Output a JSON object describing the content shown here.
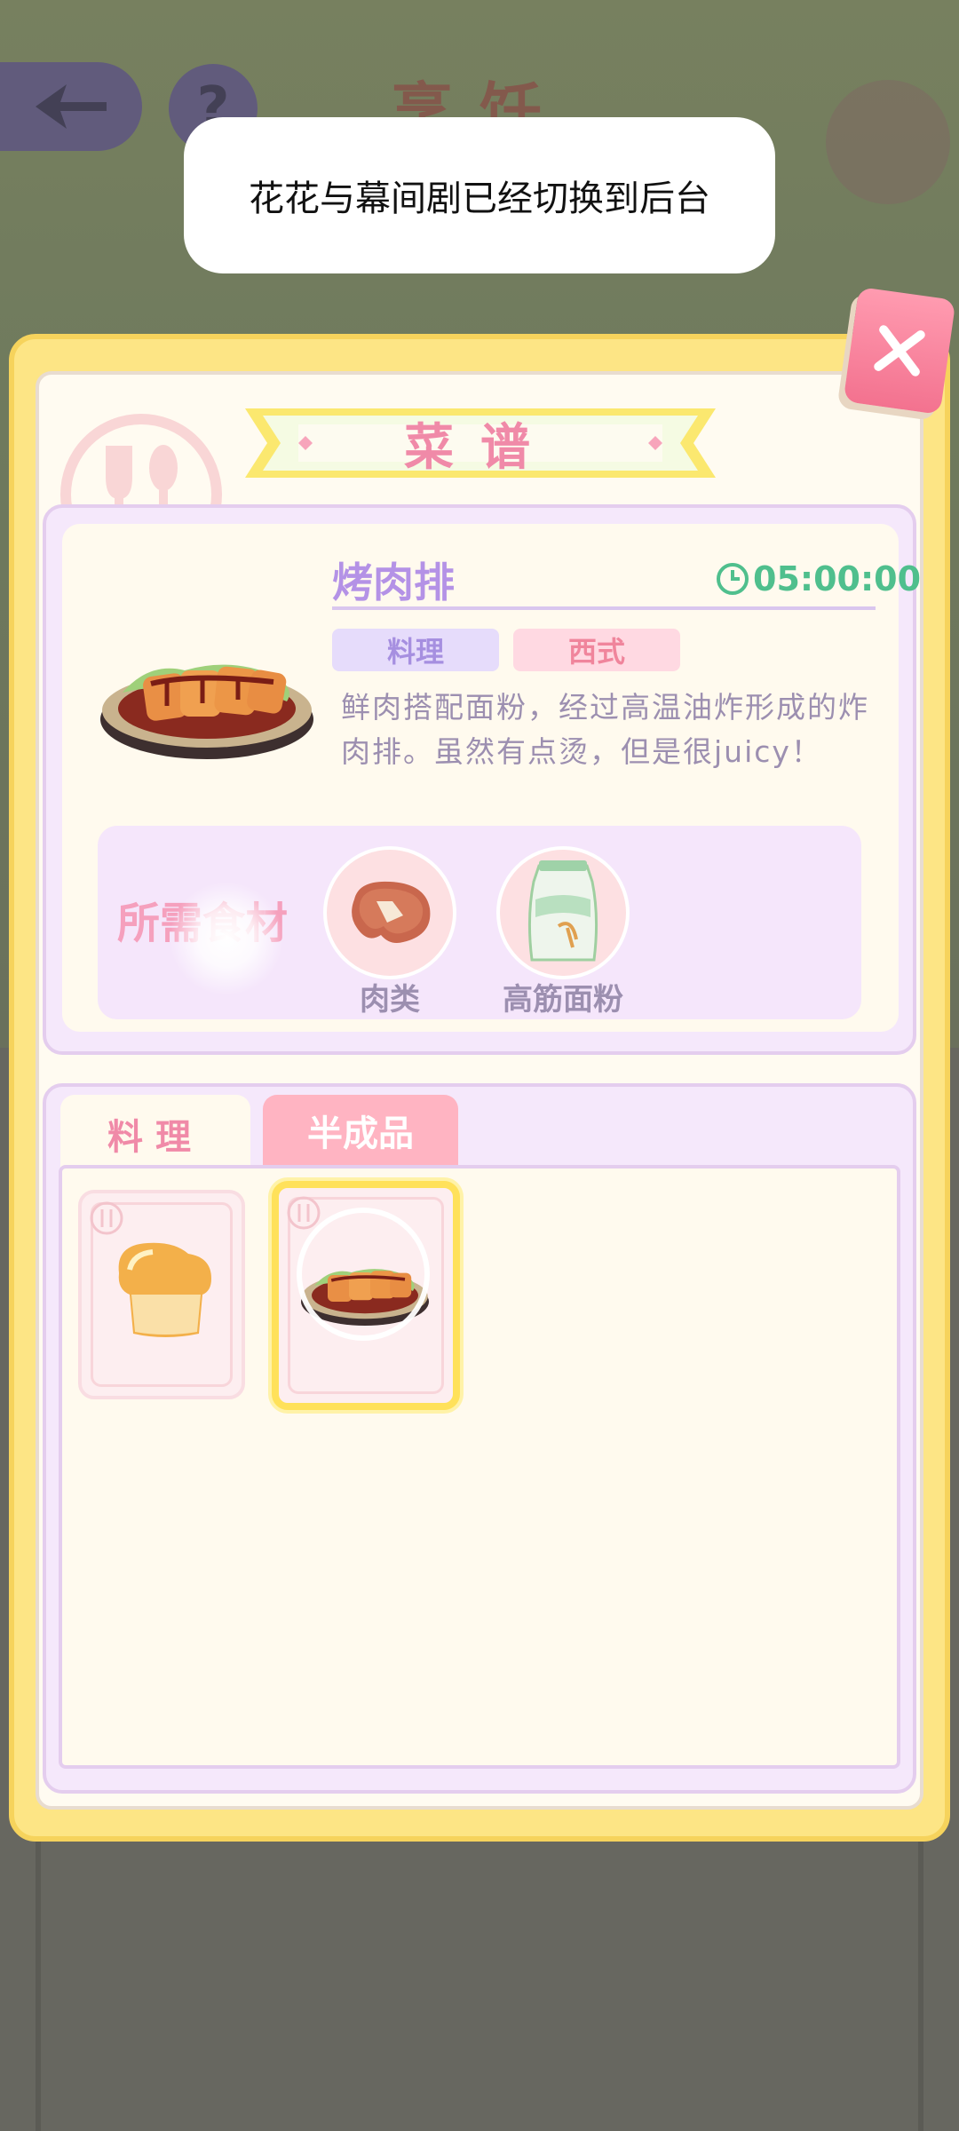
{
  "toast": {
    "message": "花花与幕间剧已经切换到后台"
  },
  "background": {
    "title": "烹饪",
    "help": "?"
  },
  "panel": {
    "title": "菜谱",
    "recipe": {
      "name": "烤肉排",
      "timer": "05:00:00",
      "tags": [
        "料理",
        "西式"
      ],
      "description": "鲜肉搭配面粉，经过高温油炸形成的炸肉排。虽然有点烫，但是很juicy！",
      "ingredients_title": "所需食材",
      "ingredients": [
        {
          "name": "肉类",
          "icon": "meat-icon"
        },
        {
          "name": "高筋面粉",
          "icon": "flour-bag-icon"
        }
      ]
    },
    "tabs": [
      {
        "label": "料理",
        "active": true
      },
      {
        "label": "半成品",
        "active": false
      }
    ],
    "items": [
      {
        "icon": "bread-icon",
        "selected": false
      },
      {
        "icon": "pork-cutlet-icon",
        "selected": true
      }
    ]
  },
  "colors": {
    "panel_border": "#fde585",
    "accent_pink": "#f08aa8",
    "accent_purple": "#b492e6",
    "timer_green": "#4fbf8d"
  }
}
